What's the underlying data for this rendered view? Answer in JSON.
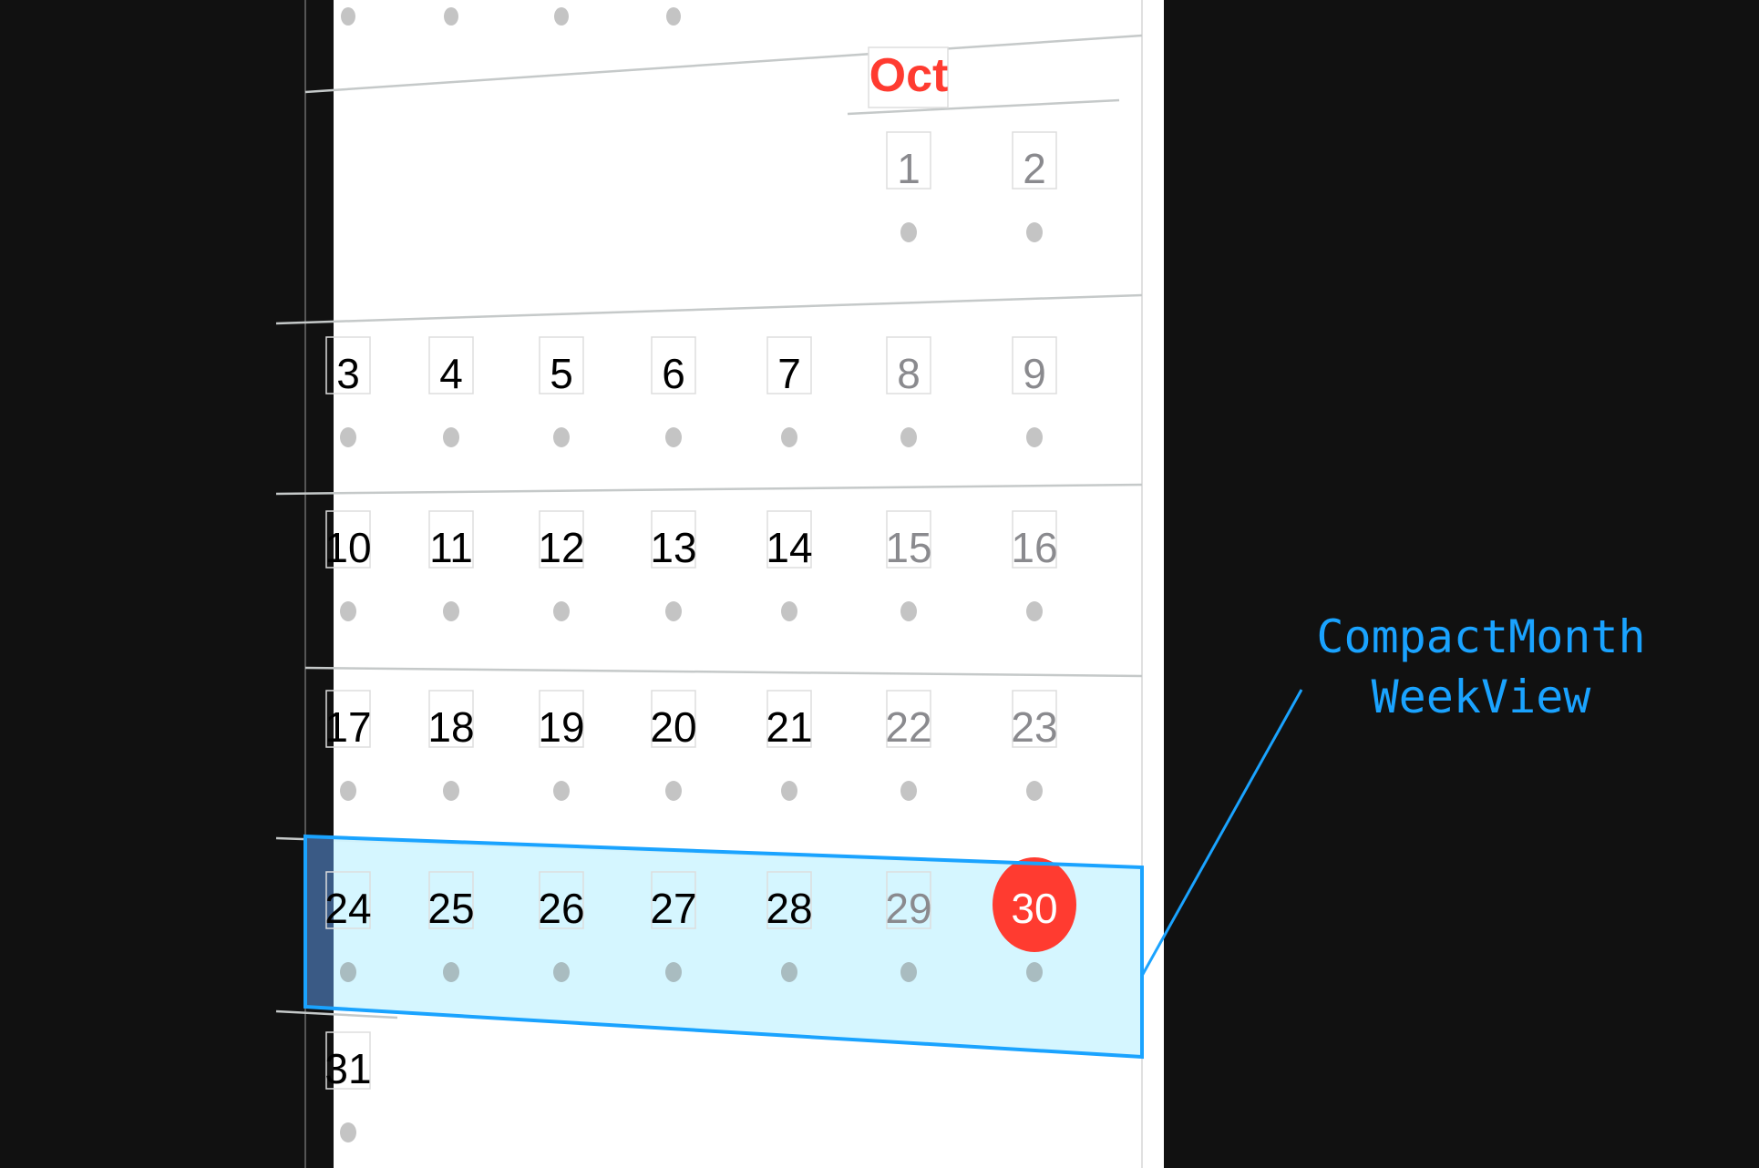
{
  "calendar": {
    "month_label": "Oct",
    "today": "30",
    "weeks": [
      [
        "",
        "",
        "",
        "",
        "",
        "1",
        "2"
      ],
      [
        "3",
        "4",
        "5",
        "6",
        "7",
        "8",
        "9"
      ],
      [
        "10",
        "11",
        "12",
        "13",
        "14",
        "15",
        "16"
      ],
      [
        "17",
        "18",
        "19",
        "20",
        "21",
        "22",
        "23"
      ],
      [
        "24",
        "25",
        "26",
        "27",
        "28",
        "29",
        "30"
      ],
      [
        "31",
        "",
        "",
        "",
        "",
        "",
        ""
      ]
    ],
    "highlighted_week_index": 4
  },
  "annotation": {
    "line1": "CompactMonth",
    "line2": "WeekView"
  },
  "colors": {
    "accent_red": "#ff3b30",
    "annotation_blue": "#1aa3ff",
    "highlight_fill": "#d0f5ff",
    "weekday_text": "#000000",
    "weekend_text": "#8a8a8e",
    "dot": "#c4c4c4"
  }
}
